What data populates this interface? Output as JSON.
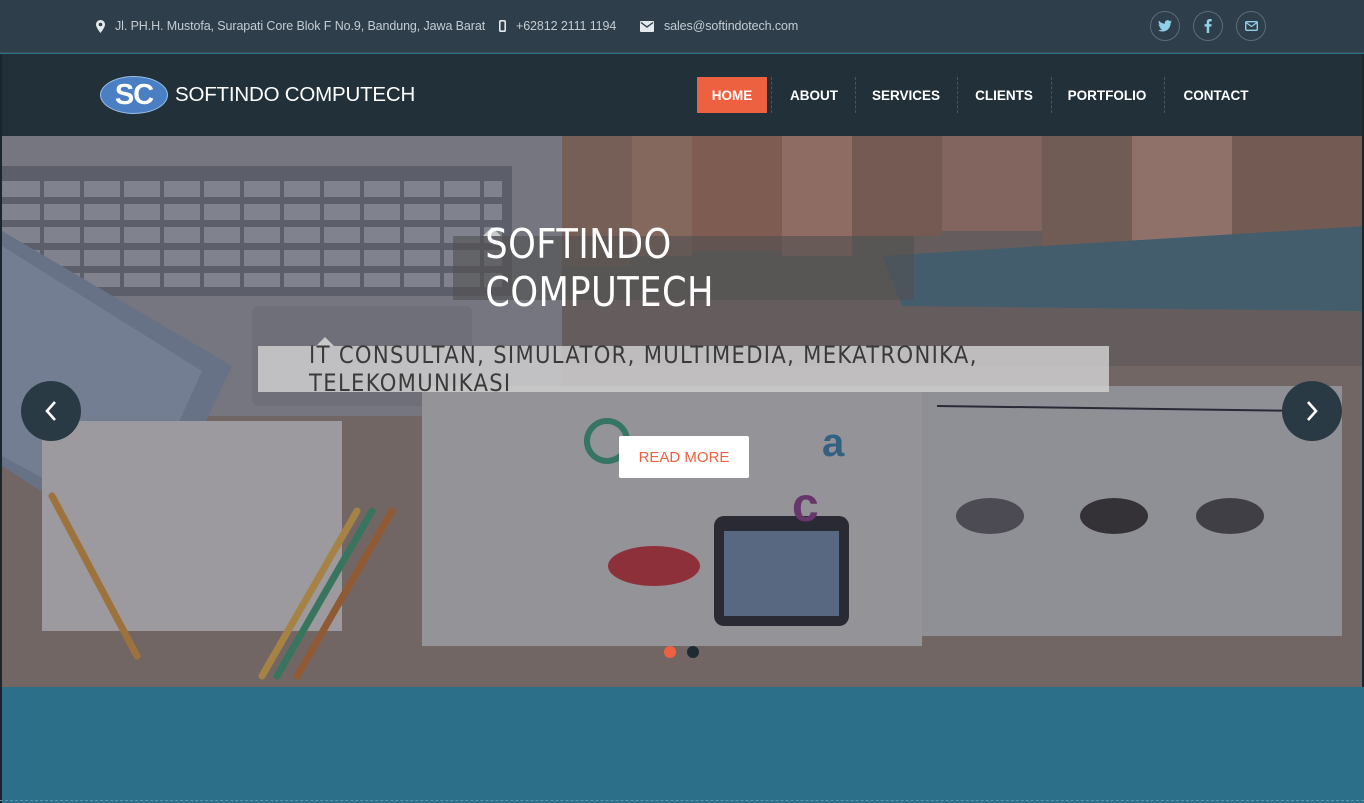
{
  "topbar": {
    "address": "Jl. PH.H. Mustofa, Surapati Core Blok F No.9, Bandung, Jawa Barat",
    "phone": "+62812 2111 1194",
    "email": "sales@softindotech.com",
    "address_icon": "map-marker-icon",
    "phone_icon": "mobile-phone-icon",
    "email_icon": "envelope-icon",
    "social": [
      "twitter-icon",
      "facebook-icon",
      "envelope-icon"
    ]
  },
  "brand": {
    "logo_badge": "SC",
    "name": "SOFTINDO COMPUTECH"
  },
  "nav": {
    "items": [
      {
        "label": "HOME",
        "active": true
      },
      {
        "label": "ABOUT",
        "active": false
      },
      {
        "label": "SERVICES",
        "active": false
      },
      {
        "label": "CLIENTS",
        "active": false
      },
      {
        "label": "PORTFOLIO",
        "active": false
      },
      {
        "label": "CONTACT",
        "active": false
      }
    ]
  },
  "slider": {
    "title": "SOFTINDO COMPUTECH",
    "subtitle": "IT CONSULTAN, SIMULATOR, MULTIMEDIA, MEKATRONIKA, TELEKOMUNIKASI",
    "button_label": "READ MORE",
    "prev_icon": "chevron-left-icon",
    "next_icon": "chevron-right-icon",
    "slide_count": 2,
    "active_slide": 1
  },
  "colors": {
    "accent": "#ee6140",
    "topbar_bg": "#2e3e4a",
    "navbar_bg": "#223039",
    "band_bg": "#2b6f88",
    "social_icon": "#8fd0e6"
  }
}
